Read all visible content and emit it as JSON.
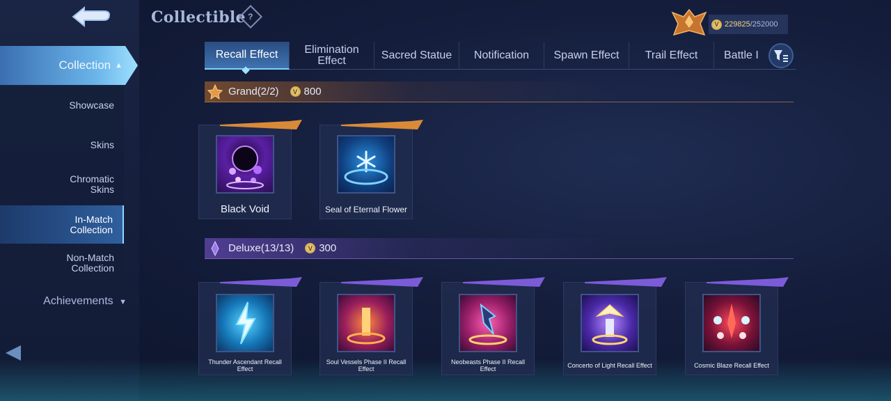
{
  "header": {
    "title": "Collectible",
    "help_symbol": "?"
  },
  "currency": {
    "value": "229825",
    "max": "/252000"
  },
  "sidebar": {
    "collection_label": "Collection",
    "items": [
      {
        "label": "Showcase"
      },
      {
        "label": "Skins"
      },
      {
        "label_line1": "Chromatic",
        "label_line2": "Skins"
      },
      {
        "label_line1": "In-Match",
        "label_line2": "Collection"
      },
      {
        "label_line1": "Non-Match",
        "label_line2": "Collection"
      }
    ],
    "achievements_label": "Achievements"
  },
  "tabs": [
    {
      "label": "Recall Effect"
    },
    {
      "label_line1": "Elimination",
      "label_line2": "Effect"
    },
    {
      "label": "Sacred Statue"
    },
    {
      "label": "Notification"
    },
    {
      "label": "Spawn Effect"
    },
    {
      "label": "Trail Effect"
    },
    {
      "label": "Battle I"
    }
  ],
  "sections": {
    "grand": {
      "label": "Grand(2/2)",
      "price": "800"
    },
    "deluxe": {
      "label": "Deluxe(13/13)",
      "price": "300"
    }
  },
  "grand_items": [
    {
      "name": "Black Void"
    },
    {
      "name": "Seal of Eternal Flower"
    }
  ],
  "deluxe_items": [
    {
      "name": "Thunder Ascendant Recall Effect"
    },
    {
      "name": "Soul Vessels Phase II Recall Effect"
    },
    {
      "name": "Neobeasts Phase II Recall Effect"
    },
    {
      "name": "Concerto of Light Recall Effect"
    },
    {
      "name": "Cosmic Blaze Recall Effect"
    }
  ],
  "colors": {
    "accent_blue": "#7fd2ff",
    "grand_gold": "#e0a14a",
    "deluxe_purple": "#8f6fe0",
    "currency_gold": "#f3d387"
  }
}
